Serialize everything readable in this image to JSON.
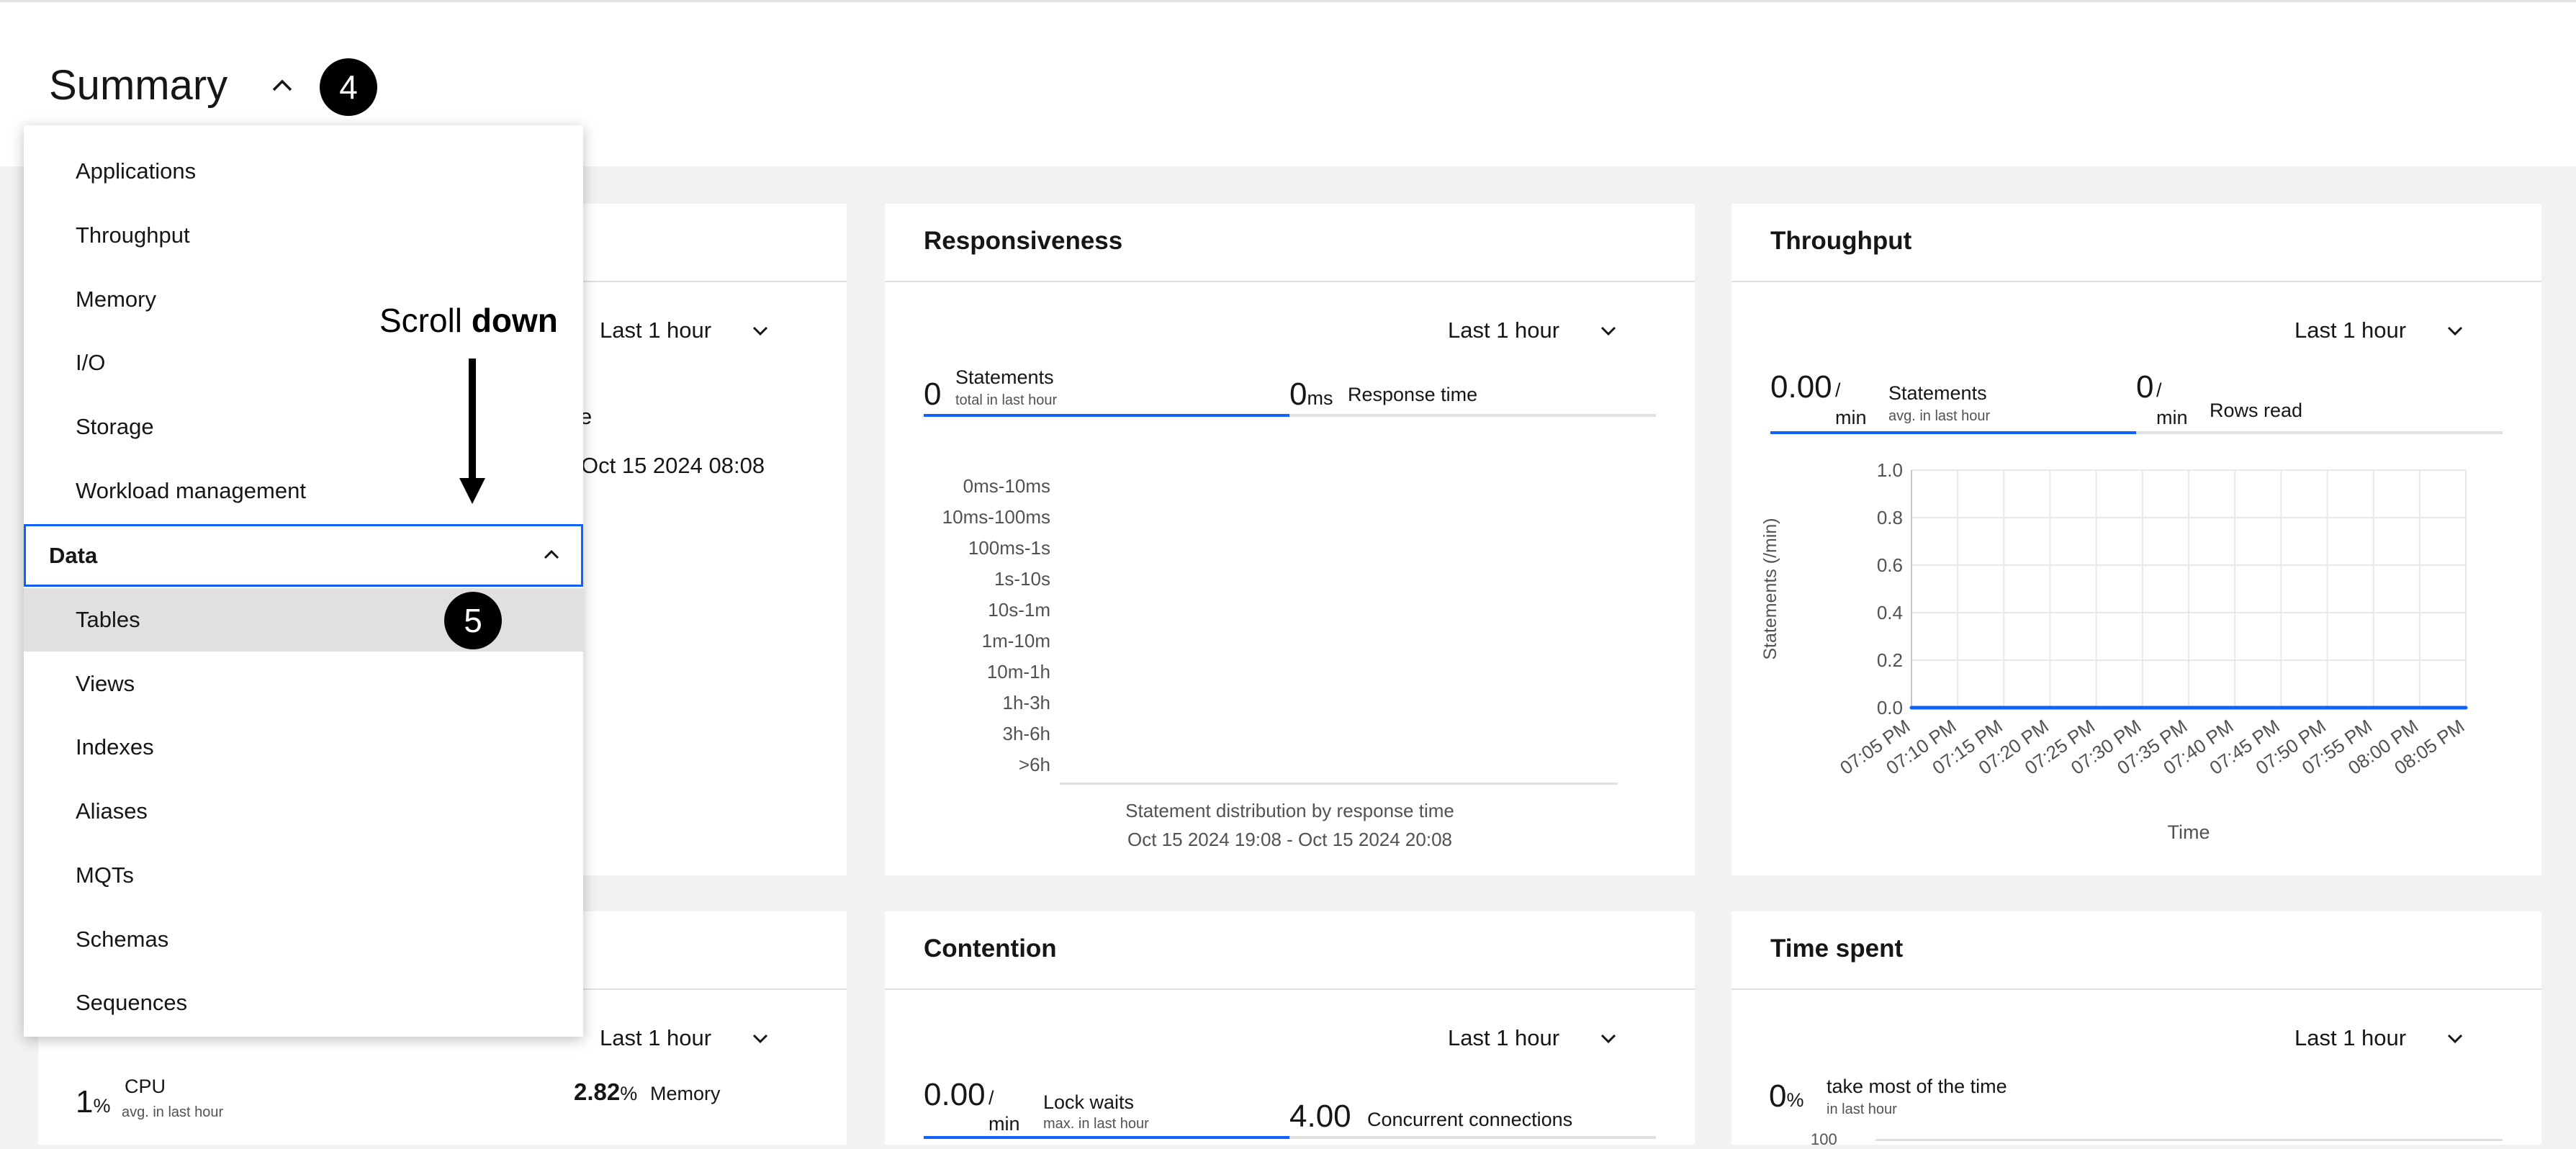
{
  "header": {
    "title": "Summary"
  },
  "annotations": {
    "step4": "4",
    "step5": "5",
    "scroll_prefix": "Scroll ",
    "scroll_bold": "down"
  },
  "menu": {
    "items_top": [
      "Applications",
      "Throughput",
      "Memory",
      "I/O",
      "Storage",
      "Workload management"
    ],
    "group_label": "Data",
    "items_data": [
      "Tables",
      "Views",
      "Indexes",
      "Aliases",
      "MQTs",
      "Schemas",
      "Sequences"
    ]
  },
  "card1": {
    "range": "Last 1 hour",
    "partial_date": "Oct 15 2024 08:08",
    "partial_char": "e"
  },
  "responsiveness": {
    "title": "Responsiveness",
    "range": "Last 1 hour",
    "statements_value": "0",
    "statements_label": "Statements",
    "statements_sub": "total in last hour",
    "response_value": "0",
    "response_unit": "ms",
    "response_label": "Response time",
    "buckets": [
      "0ms-10ms",
      "10ms-100ms",
      "100ms-1s",
      "1s-10s",
      "10s-1m",
      "1m-10m",
      "10m-1h",
      "1h-3h",
      "3h-6h",
      ">6h"
    ],
    "caption": "Statement distribution by response time",
    "daterange": "Oct 15 2024 19:08 - Oct 15 2024 20:08"
  },
  "throughput": {
    "title": "Throughput",
    "range": "Last 1 hour",
    "stmt_value": "0.00",
    "stmt_unit_top": "/",
    "stmt_unit_bottom": "min",
    "stmt_label": "Statements",
    "stmt_sub": "avg. in last hour",
    "rows_value": "0",
    "rows_unit_top": "/",
    "rows_unit_bottom": "min",
    "rows_label": "Rows read"
  },
  "chart_data": {
    "type": "line",
    "x": [
      "07:05 PM",
      "07:10 PM",
      "07:15 PM",
      "07:20 PM",
      "07:25 PM",
      "07:30 PM",
      "07:35 PM",
      "07:40 PM",
      "07:45 PM",
      "07:50 PM",
      "07:55 PM",
      "08:00 PM",
      "08:05 PM"
    ],
    "series": [
      {
        "values": [
          0,
          0,
          0,
          0,
          0,
          0,
          0,
          0,
          0,
          0,
          0,
          0,
          0
        ]
      }
    ],
    "yticks": [
      "1.0",
      "0.8",
      "0.6",
      "0.4",
      "0.2",
      "0.0"
    ],
    "ylim": [
      0,
      1
    ],
    "xlabel": "Time",
    "ylabel": "Statements (/min)",
    "grid": true
  },
  "card4": {
    "range": "Last 1 hour",
    "cpu_value": "1",
    "cpu_unit": "%",
    "cpu_label": "CPU",
    "cpu_sub": "avg. in last hour",
    "mem_value": "2.82",
    "mem_unit": "%",
    "mem_label": "Memory"
  },
  "contention": {
    "title": "Contention",
    "range": "Last 1 hour",
    "lock_value": "0.00",
    "lock_unit_top": "/",
    "lock_unit_bottom": "min",
    "lock_label": "Lock waits",
    "lock_sub": "max. in last hour",
    "conn_value": "4.00",
    "conn_label": "Concurrent connections"
  },
  "timespent": {
    "title": "Time spent",
    "range": "Last 1 hour",
    "value": "0",
    "unit": "%",
    "label": "take most of the time",
    "sub": "in last hour",
    "partial_tick": "100"
  },
  "colors": {
    "accent": "#0f62fe",
    "highlight": "#e0e0e0"
  }
}
